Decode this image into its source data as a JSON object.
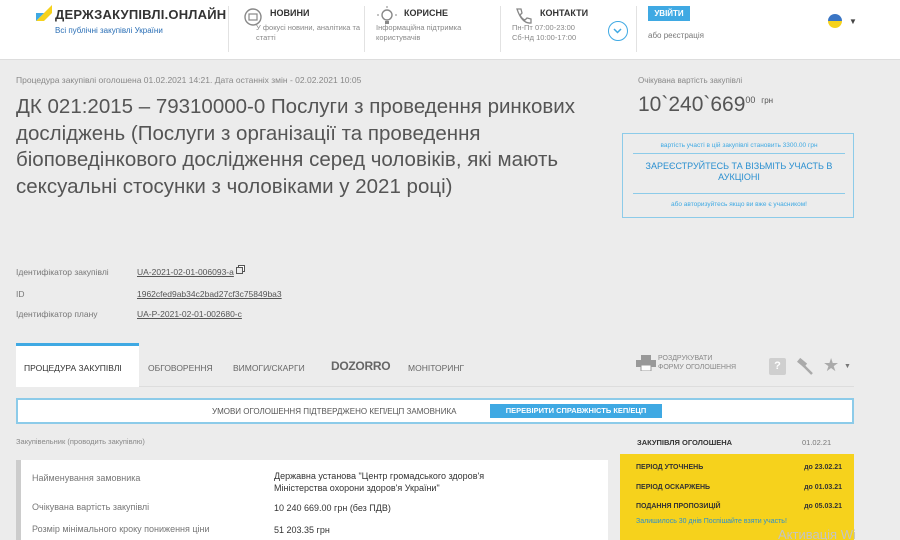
{
  "header": {
    "logo_text": "ДЕРЖЗАКУПІВЛІ.ОНЛАЙН",
    "logo_sub": "Всі публічні закупівлі України",
    "news": {
      "title": "НОВИНИ",
      "desc_line1": "У фокусі новини, аналітика та",
      "desc_line2": "статті"
    },
    "useful": {
      "title": "КОРИСНЕ",
      "desc_line1": "Інформаційна підтримка",
      "desc_line2": "користувачів"
    },
    "contacts": {
      "title": "КОНТАКТИ",
      "desc_line1": "Пн-Пт 07:00-23:00",
      "desc_line2": "Сб-Нд 10:00-17:00"
    },
    "login_label": "УВІЙТИ",
    "register_label": "або реєстрація",
    "accent_color": "#3fa9e3"
  },
  "procedure": {
    "published_info": "Процедура закупівлі оголошена 01.02.2021 14:21. Дата останніх змін - 02.02.2021 10:05",
    "title": "ДК 021:2015 – 79310000-0 Послуги з проведення ринкових досліджень (Послуги з організації та проведення біоповедінкового дослідження серед чоловіків, які мають сексуальні стосунки з чоловіками у 2021 році)",
    "budget_label": "Очікувана вартість закупівлі",
    "budget_main": "10`240`669",
    "budget_cents": "00",
    "budget_currency": "грн",
    "participation_cost": "вартість участі в цій закупівлі становить 3300.00 грн",
    "participate_cta": "ЗАРЕЄСТРУЙТЕСЬ ТА ВІЗЬМІТЬ УЧАСТЬ В АУКЦІОНІ",
    "participate_auth": "або авторизуйтесь якщо ви вже є учасником!",
    "ids": [
      {
        "label": "Ідентифікатор закупівлі",
        "value": "UA-2021-02-01-006093-a"
      },
      {
        "label": "ID",
        "value": "1962cfed9ab34c2bad27cf3c75849ba3"
      },
      {
        "label": "Ідентифікатор плану",
        "value": "UA-P-2021-02-01-002680-c"
      }
    ]
  },
  "tabs": {
    "procedure": "ПРОЦЕДУРА ЗАКУПІВЛІ",
    "discussion": "ОБГОВОРЕННЯ",
    "complaints": "ВИМОГИ/СКАРГИ",
    "dozorro": "DOZORRO",
    "monitoring": "МОНІТОРИНГ",
    "print_line1": "РОЗДРУКУВАТИ",
    "print_line2": "ФОРМУ ОГОЛОШЕННЯ",
    "help_glyph": "?"
  },
  "ecp": {
    "text": "УМОВИ ОГОЛОШЕННЯ ПІДТВЕРДЖЕНО КЕП/ЕЦП ЗАМОВНИКА",
    "button": "ПЕРЕВІРИТИ СПРАВЖНІСТЬ КЕП/ЕЦП"
  },
  "customer": {
    "header": "Закупівельник (проводить закупівлю)",
    "rows": [
      {
        "label": "Найменування замовника",
        "value_line1": "Державна установа \"Центр громадського здоров'я",
        "value_line2": "Міністерства охорони здоров'я України\""
      },
      {
        "label": "Очікувана вартість закупівлі",
        "value_line1": "10 240 669.00 грн (без ПДВ)"
      },
      {
        "label": "Розмір мінімального кроку пониження ціни",
        "value_line1": "51 203.35 грн"
      }
    ]
  },
  "timeline": {
    "title": "ЗАКУПІВЛЯ ОГОЛОШЕНА",
    "date": "01.02.21",
    "rows": [
      {
        "label": "ПЕРІОД УТОЧНЕНЬ",
        "value": "до 23.02.21"
      },
      {
        "label": "ПЕРІОД ОСКАРЖЕНЬ",
        "value": "до 01.03.21"
      },
      {
        "label": "ПОДАННЯ ПРОПОЗИЦІЙ",
        "value": "до 05.03.21"
      }
    ],
    "remaining": "Залишилось 30 днів Поспішайте взяти участь!",
    "highlight_color": "#f6d21c"
  },
  "watermark": "Активація Wi"
}
